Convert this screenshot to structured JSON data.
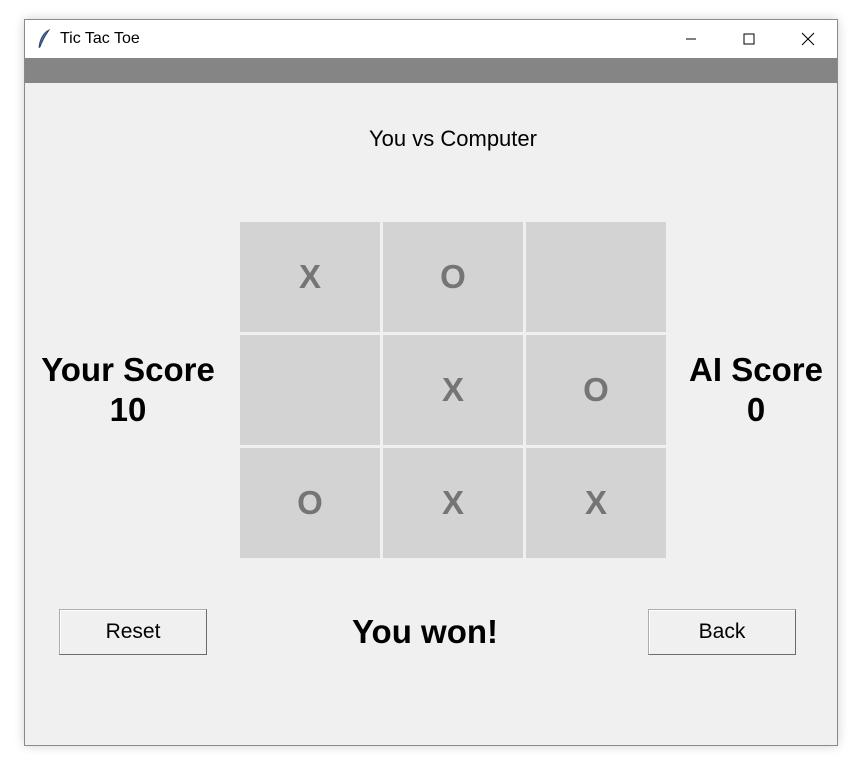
{
  "window": {
    "title": "Tic Tac Toe",
    "icon": "feather-icon"
  },
  "header": {
    "mode_label": "You vs Computer"
  },
  "scores": {
    "player_label": "Your Score",
    "player_value": "10",
    "ai_label": "AI Score",
    "ai_value": "0"
  },
  "board": {
    "cells": [
      "X",
      "O",
      "",
      "",
      "X",
      "O",
      "O",
      "X",
      "X"
    ]
  },
  "controls": {
    "reset_label": "Reset",
    "back_label": "Back"
  },
  "status": {
    "message": "You won!"
  },
  "colors": {
    "window_bg": "#f0f0f0",
    "menubar": "#858585",
    "cell_bg": "#d3d3d3",
    "mark_color": "#757575"
  }
}
